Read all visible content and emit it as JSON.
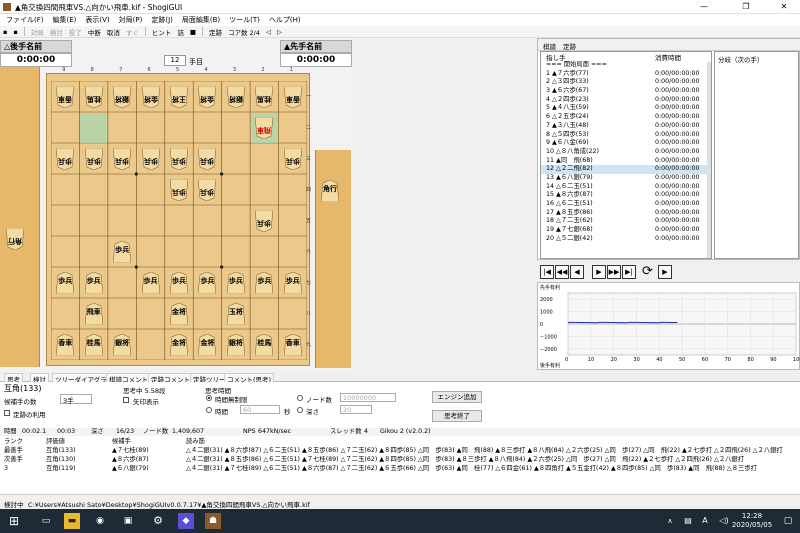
{
  "window": {
    "title": "▲角交換四間飛車VS.△向かい飛車.kif - ShogiGUI",
    "min": "—",
    "max": "❐",
    "close": "✕"
  },
  "menu": [
    "ファイル(F)",
    "編集(E)",
    "表示(V)",
    "対局(P)",
    "定跡(J)",
    "局面編集(B)",
    "ツール(T)",
    "ヘルプ(H)"
  ],
  "toolbar": {
    "items": [
      "対局",
      "検討",
      "投了",
      "中断",
      "取消",
      "すぐ",
      "ヒント",
      "詰",
      "定跡",
      "コア数 2/4"
    ]
  },
  "players": {
    "gote_name": "△後手名前",
    "gote_time": "0:00:00",
    "sente_name": "▲先手名前",
    "sente_time": "0:00:00",
    "move_no": "12",
    "move_unit": "手目"
  },
  "board": {
    "files": [
      "9",
      "8",
      "7",
      "6",
      "5",
      "4",
      "3",
      "2",
      "1"
    ],
    "ranks": [
      "一",
      "二",
      "三",
      "四",
      "五",
      "六",
      "七",
      "八",
      "九"
    ],
    "highlight_squares": [
      [
        2,
        8
      ],
      [
        2,
        2
      ]
    ],
    "pieces": [
      {
        "f": 9,
        "r": 1,
        "t": "香車",
        "o": "g"
      },
      {
        "f": 8,
        "r": 1,
        "t": "桂馬",
        "o": "g"
      },
      {
        "f": 7,
        "r": 1,
        "t": "銀将",
        "o": "g"
      },
      {
        "f": 6,
        "r": 1,
        "t": "金将",
        "o": "g"
      },
      {
        "f": 5,
        "r": 1,
        "t": "王将",
        "o": "g"
      },
      {
        "f": 4,
        "r": 1,
        "t": "金将",
        "o": "g"
      },
      {
        "f": 3,
        "r": 1,
        "t": "銀将",
        "o": "g"
      },
      {
        "f": 2,
        "r": 1,
        "t": "桂馬",
        "o": "g"
      },
      {
        "f": 1,
        "r": 1,
        "t": "香車",
        "o": "g"
      },
      {
        "f": 2,
        "r": 2,
        "t": "飛車",
        "o": "g"
      },
      {
        "f": 9,
        "r": 3,
        "t": "歩兵",
        "o": "g"
      },
      {
        "f": 8,
        "r": 3,
        "t": "歩兵",
        "o": "g"
      },
      {
        "f": 7,
        "r": 3,
        "t": "歩兵",
        "o": "g"
      },
      {
        "f": 6,
        "r": 3,
        "t": "歩兵",
        "o": "g"
      },
      {
        "f": 5,
        "r": 3,
        "t": "歩兵",
        "o": "g"
      },
      {
        "f": 4,
        "r": 3,
        "t": "歩兵",
        "o": "g"
      },
      {
        "f": 1,
        "r": 3,
        "t": "歩兵",
        "o": "g"
      },
      {
        "f": 5,
        "r": 4,
        "t": "歩兵",
        "o": "g"
      },
      {
        "f": 4,
        "r": 4,
        "t": "歩兵",
        "o": "g"
      },
      {
        "f": 2,
        "r": 5,
        "t": "歩兵",
        "o": "g"
      },
      {
        "f": 7,
        "r": 6,
        "t": "歩兵",
        "o": "s"
      },
      {
        "f": 9,
        "r": 7,
        "t": "歩兵",
        "o": "s"
      },
      {
        "f": 8,
        "r": 7,
        "t": "歩兵",
        "o": "s"
      },
      {
        "f": 6,
        "r": 7,
        "t": "歩兵",
        "o": "s"
      },
      {
        "f": 5,
        "r": 7,
        "t": "歩兵",
        "o": "s"
      },
      {
        "f": 4,
        "r": 7,
        "t": "歩兵",
        "o": "s"
      },
      {
        "f": 3,
        "r": 7,
        "t": "歩兵",
        "o": "s"
      },
      {
        "f": 2,
        "r": 7,
        "t": "歩兵",
        "o": "s"
      },
      {
        "f": 1,
        "r": 7,
        "t": "歩兵",
        "o": "s"
      },
      {
        "f": 8,
        "r": 8,
        "t": "飛車",
        "o": "s"
      },
      {
        "f": 5,
        "r": 8,
        "t": "金将",
        "o": "s"
      },
      {
        "f": 3,
        "r": 8,
        "t": "玉将",
        "o": "s"
      },
      {
        "f": 9,
        "r": 9,
        "t": "香車",
        "o": "s"
      },
      {
        "f": 8,
        "r": 9,
        "t": "桂馬",
        "o": "s"
      },
      {
        "f": 7,
        "r": 9,
        "t": "銀将",
        "o": "s"
      },
      {
        "f": 5,
        "r": 9,
        "t": "金将",
        "o": "s"
      },
      {
        "f": 4,
        "r": 9,
        "t": "金将",
        "o": "s"
      },
      {
        "f": 3,
        "r": 9,
        "t": "銀将",
        "o": "s"
      },
      {
        "f": 2,
        "r": 9,
        "t": "桂馬",
        "o": "s"
      },
      {
        "f": 1,
        "r": 9,
        "t": "香車",
        "o": "s"
      }
    ],
    "hand_gote": "角行",
    "hand_sente": "角行"
  },
  "kifu": {
    "tabs": [
      "棋譜",
      "定跡"
    ],
    "col_move": "指し手",
    "col_time": "消費時間",
    "branch_header": "分岐（次の手）",
    "start": "===  開始局面  ===",
    "selected": 12,
    "rows": [
      {
        "move": "1 ▲７六歩(77)",
        "time": "0:00/00:00:00"
      },
      {
        "move": "2 △３四歩(33)",
        "time": "0:00/00:00:00"
      },
      {
        "move": "3 ▲６六歩(67)",
        "time": "0:00/00:00:00"
      },
      {
        "move": "4 △２四歩(23)",
        "time": "0:00/00:00:00"
      },
      {
        "move": "5 ▲４八玉(59)",
        "time": "0:00/00:00:00"
      },
      {
        "move": "6 △２五歩(24)",
        "time": "0:00/00:00:00"
      },
      {
        "move": "7 ▲３八玉(48)",
        "time": "0:00/00:00:00"
      },
      {
        "move": "8 △５四歩(53)",
        "time": "0:00/00:00:00"
      },
      {
        "move": "9 ▲６八金(69)",
        "time": "0:00/00:00:00"
      },
      {
        "move": "10 △８八角成(22)",
        "time": "0:00/00:00:00"
      },
      {
        "move": "11 ▲同　飛(68)",
        "time": "0:00/00:00:00"
      },
      {
        "move": "12 △２二飛(82)",
        "time": "0:00/00:00:00"
      },
      {
        "move": "13 ▲６八銀(79)",
        "time": "0:00/00:00:00"
      },
      {
        "move": "14 △６二玉(51)",
        "time": "0:00/00:00:00"
      },
      {
        "move": "15 ▲８六歩(87)",
        "time": "0:00/00:00:00"
      },
      {
        "move": "16 △６二玉(51)",
        "time": "0:00/00:00:00"
      },
      {
        "move": "17 ▲８五歩(86)",
        "time": "0:00/00:00:00"
      },
      {
        "move": "18 △７二玉(62)",
        "time": "0:00/00:00:00"
      },
      {
        "move": "19 ▲７七銀(68)",
        "time": "0:00/00:00:00"
      },
      {
        "move": "20 △５二銀(42)",
        "time": "0:00/00:00:00"
      }
    ]
  },
  "graph": {
    "top_label": "先手有利",
    "bottom_label": "後手有利",
    "y_ticks": [
      "2000",
      "1000",
      "0",
      "−1000",
      "−2000"
    ],
    "x_ticks": [
      "0",
      "10",
      "20",
      "30",
      "40",
      "50",
      "60",
      "70",
      "80",
      "90",
      "100"
    ]
  },
  "bottom_tabs": [
    "思考",
    "検討",
    "ツリーダイアグラム",
    "棋譜コメント",
    "定跡コメント",
    "定跡ツリー",
    "コメント(思考)"
  ],
  "study": {
    "eval_label": "互角(133)",
    "candidates_label": "候補手の数",
    "candidates_value": "3手",
    "joseki_use": "定跡の利用",
    "thinking_level": "思考中 5.58段",
    "arrow_display": "矢印表示",
    "think_time_label": "思考時間",
    "unlimited": "時間無制限",
    "time_label": "時間",
    "time_value": "60",
    "sec": "秒",
    "nodes_label": "ノード数",
    "nodes_value": "10000000",
    "depth_label": "深さ",
    "depth_value": "20",
    "add_engine": "エンジン追加",
    "end_thinking": "思考終了",
    "stats": {
      "time_lbl": "時間",
      "time": "00:02.1",
      "time2": "00:03",
      "depth_lbl": "深さ",
      "depth": "16/23",
      "nodes_lbl": "ノード数",
      "nodes": "1,409,607",
      "nps_lbl": "NPS",
      "nps": "647kN/sec",
      "threads_lbl": "スレッド数",
      "threads": "4",
      "engine": "Gikou 2 (v2.0.2)"
    },
    "pv_header": {
      "rank": "ランク",
      "eval": "評価値",
      "move": "候補手",
      "pv": "読み筋"
    },
    "pv": [
      {
        "rank": "最善手",
        "eval": "互角(133)",
        "move": "▲７七桂(89)",
        "pv": "△４二銀(31) ▲８六歩(87) △６二玉(51) ▲８五歩(86) △７二玉(62) ▲８四歩(85) △同　歩(83) ▲同　飛(88) ▲８三歩打 ▲８八飛(84) △２六歩(25) △同　歩(27) △同　飛(22) ▲２七歩打 △２四飛(26) △２八銀打"
      },
      {
        "rank": "次善手",
        "eval": "互角(130)",
        "move": "▲８六歩(87)",
        "pv": "△４二銀(31) ▲８五歩(86) △６二玉(51) ▲７七桂(89) △７二玉(62) ▲８四歩(85) △同　歩(83) ▲８三歩打 ▲８八飛(84) ▲２六歩(25) △同　歩(27) △同　飛(22) ▲２七歩打 △２四飛(26) △２八銀打"
      },
      {
        "rank": "3",
        "eval": "互角(119)",
        "move": "▲６八銀(79)",
        "pv": "△４二銀(31) ▲７七桂(89) △６二玉(51) ▲８六歩(87) △７二玉(62) ▲６五歩(66) △同　歩(63) ▲同　桂(77) △６四金(61) ▲８四角打 ▲５五金打(42) ▲８四歩(85) △同　歩(83) ▲同　飛(88) △８三歩打"
      }
    ]
  },
  "status": {
    "label": "検討中",
    "path": "C:¥Users¥Atsushi Sato¥Desktop¥ShogiGUIv0.0.7.17¥▲角交換四間飛車VS.△向かい飛車.kif"
  },
  "taskbar": {
    "time": "12:28",
    "date": "2020/05/05",
    "ime": "A"
  },
  "colors": {
    "board": "#ecc98b",
    "komadai": "#e7b86a",
    "highlight": "#a9d6b0",
    "selected_row": "#cde6f7",
    "graph_line": "#2a2aaa"
  }
}
